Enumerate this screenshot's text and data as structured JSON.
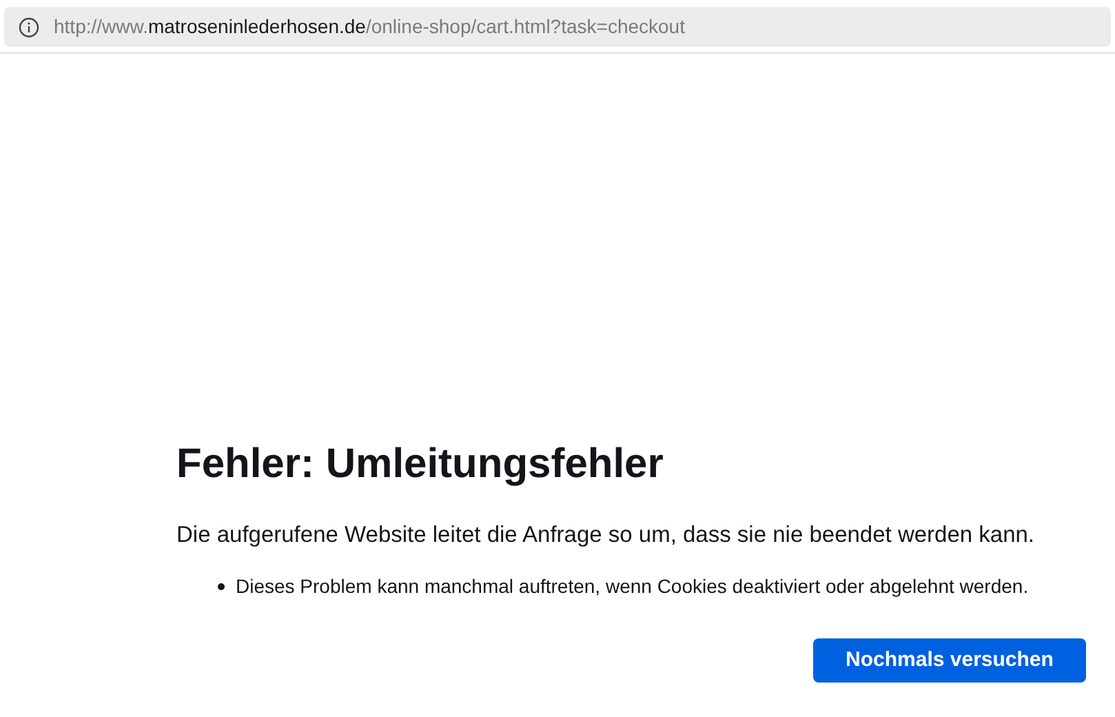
{
  "address_bar": {
    "url_prefix": "http://www.",
    "url_domain": "matroseninlederhosen.de",
    "url_path": "/online-shop/cart.html?task=checkout"
  },
  "error": {
    "title": "Fehler: Umleitungsfehler",
    "description": "Die aufgerufene Website leitet die Anfrage so um, dass sie nie beendet werden kann.",
    "hints": [
      "Dieses Problem kann manchmal auftreten, wenn Cookies deaktiviert oder abgelehnt werden."
    ],
    "button": "Nochmals versuchen"
  }
}
